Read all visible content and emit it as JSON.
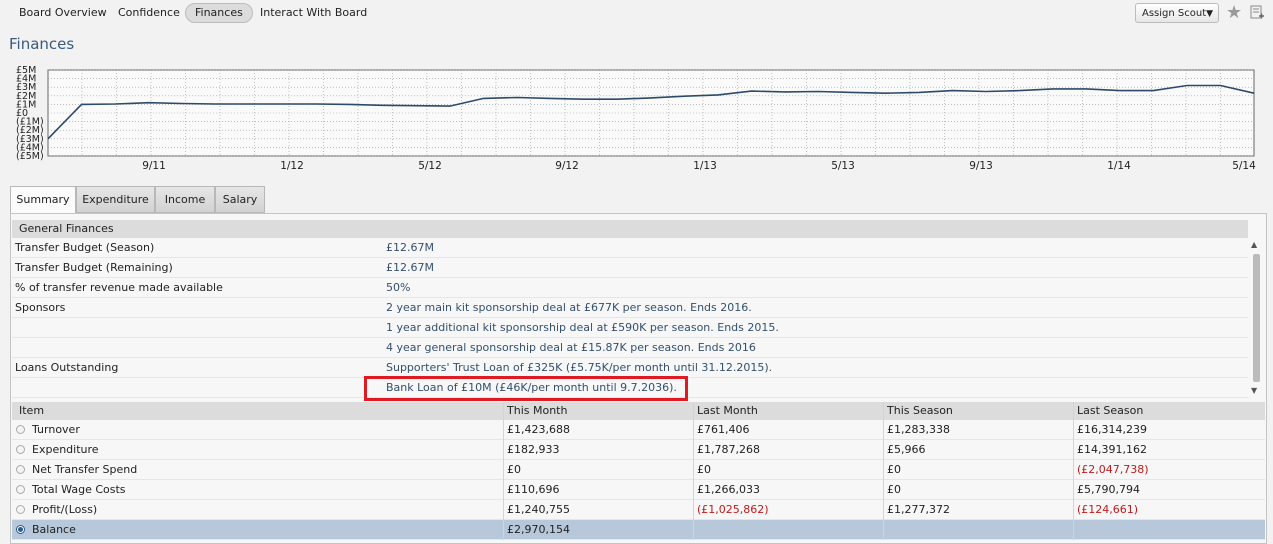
{
  "nav": {
    "tabs": [
      {
        "label": "Board Overview",
        "active": false
      },
      {
        "label": "Confidence",
        "active": false
      },
      {
        "label": "Finances",
        "active": true
      },
      {
        "label": "Interact With Board",
        "active": false
      }
    ],
    "assign_scout": "Assign Scout"
  },
  "page_title": "Finances",
  "chart_data": {
    "type": "line",
    "title": "",
    "y_tick_labels": [
      "£5M",
      "£4M",
      "£3M",
      "£2M",
      "£1M",
      "£0",
      "(£1M)",
      "(£2M)",
      "(£3M)",
      "(£4M)",
      "(£5M)"
    ],
    "ylim": [
      -5,
      5
    ],
    "x_tick_labels": [
      "9/11",
      "1/12",
      "5/12",
      "9/12",
      "1/13",
      "5/13",
      "9/13",
      "1/14",
      "5/14"
    ],
    "grid": true,
    "series": [
      {
        "color": "#2d4a6a",
        "values": [
          -3.0,
          1.0,
          1.05,
          1.2,
          1.1,
          1.05,
          1.05,
          1.05,
          1.05,
          1.0,
          0.9,
          0.85,
          0.8,
          1.7,
          1.8,
          1.7,
          1.6,
          1.6,
          1.75,
          1.95,
          2.1,
          2.55,
          2.45,
          2.5,
          2.4,
          2.3,
          2.4,
          2.6,
          2.5,
          2.6,
          2.8,
          2.8,
          2.6,
          2.6,
          3.2,
          3.2,
          2.3
        ]
      }
    ]
  },
  "subtabs": [
    "Summary",
    "Expenditure",
    "Income",
    "Salary"
  ],
  "general_finances": {
    "heading": "General Finances",
    "rows": [
      {
        "key": "Transfer Budget (Season)",
        "value": "£12.67M"
      },
      {
        "key": "Transfer Budget (Remaining)",
        "value": "£12.67M"
      },
      {
        "key": "% of transfer revenue made available",
        "value": "50%"
      },
      {
        "key": "Sponsors",
        "value": "2 year main kit sponsorship deal at £677K per season. Ends 2016."
      },
      {
        "key": "",
        "value": "1 year additional kit sponsorship deal at £590K per season. Ends 2015."
      },
      {
        "key": "",
        "value": "4 year general sponsorship deal at £15.87K per season. Ends 2016"
      },
      {
        "key": "Loans Outstanding",
        "value": "Supporters' Trust Loan of £325K (£5.75K/per month until 31.12.2015)."
      },
      {
        "key": "",
        "value": "Bank Loan of £10M (£46K/per month until 9.7.2036)."
      }
    ]
  },
  "table": {
    "headers": [
      "Item",
      "This Month",
      "Last Month",
      "This Season",
      "Last Season"
    ],
    "rows": [
      {
        "item": "Turnover",
        "this_month": "£1,423,688",
        "last_month": "£761,406",
        "this_season": "£1,283,338",
        "last_season": "£16,314,239"
      },
      {
        "item": "Expenditure",
        "this_month": "£182,933",
        "last_month": "£1,787,268",
        "this_season": "£5,966",
        "last_season": "£14,391,162"
      },
      {
        "item": "Net Transfer Spend",
        "this_month": "£0",
        "last_month": "£0",
        "this_season": "£0",
        "last_season": "(£2,047,738)"
      },
      {
        "item": "Total Wage Costs",
        "this_month": "£110,696",
        "last_month": "£1,266,033",
        "this_season": "£0",
        "last_season": "£5,790,794"
      },
      {
        "item": "Profit/(Loss)",
        "this_month": "£1,240,755",
        "last_month": "(£1,025,862)",
        "this_season": "£1,277,372",
        "last_season": "(£124,661)"
      },
      {
        "item": "Balance",
        "this_month": "£2,970,154",
        "last_month": "",
        "this_season": "",
        "last_season": ""
      }
    ]
  }
}
